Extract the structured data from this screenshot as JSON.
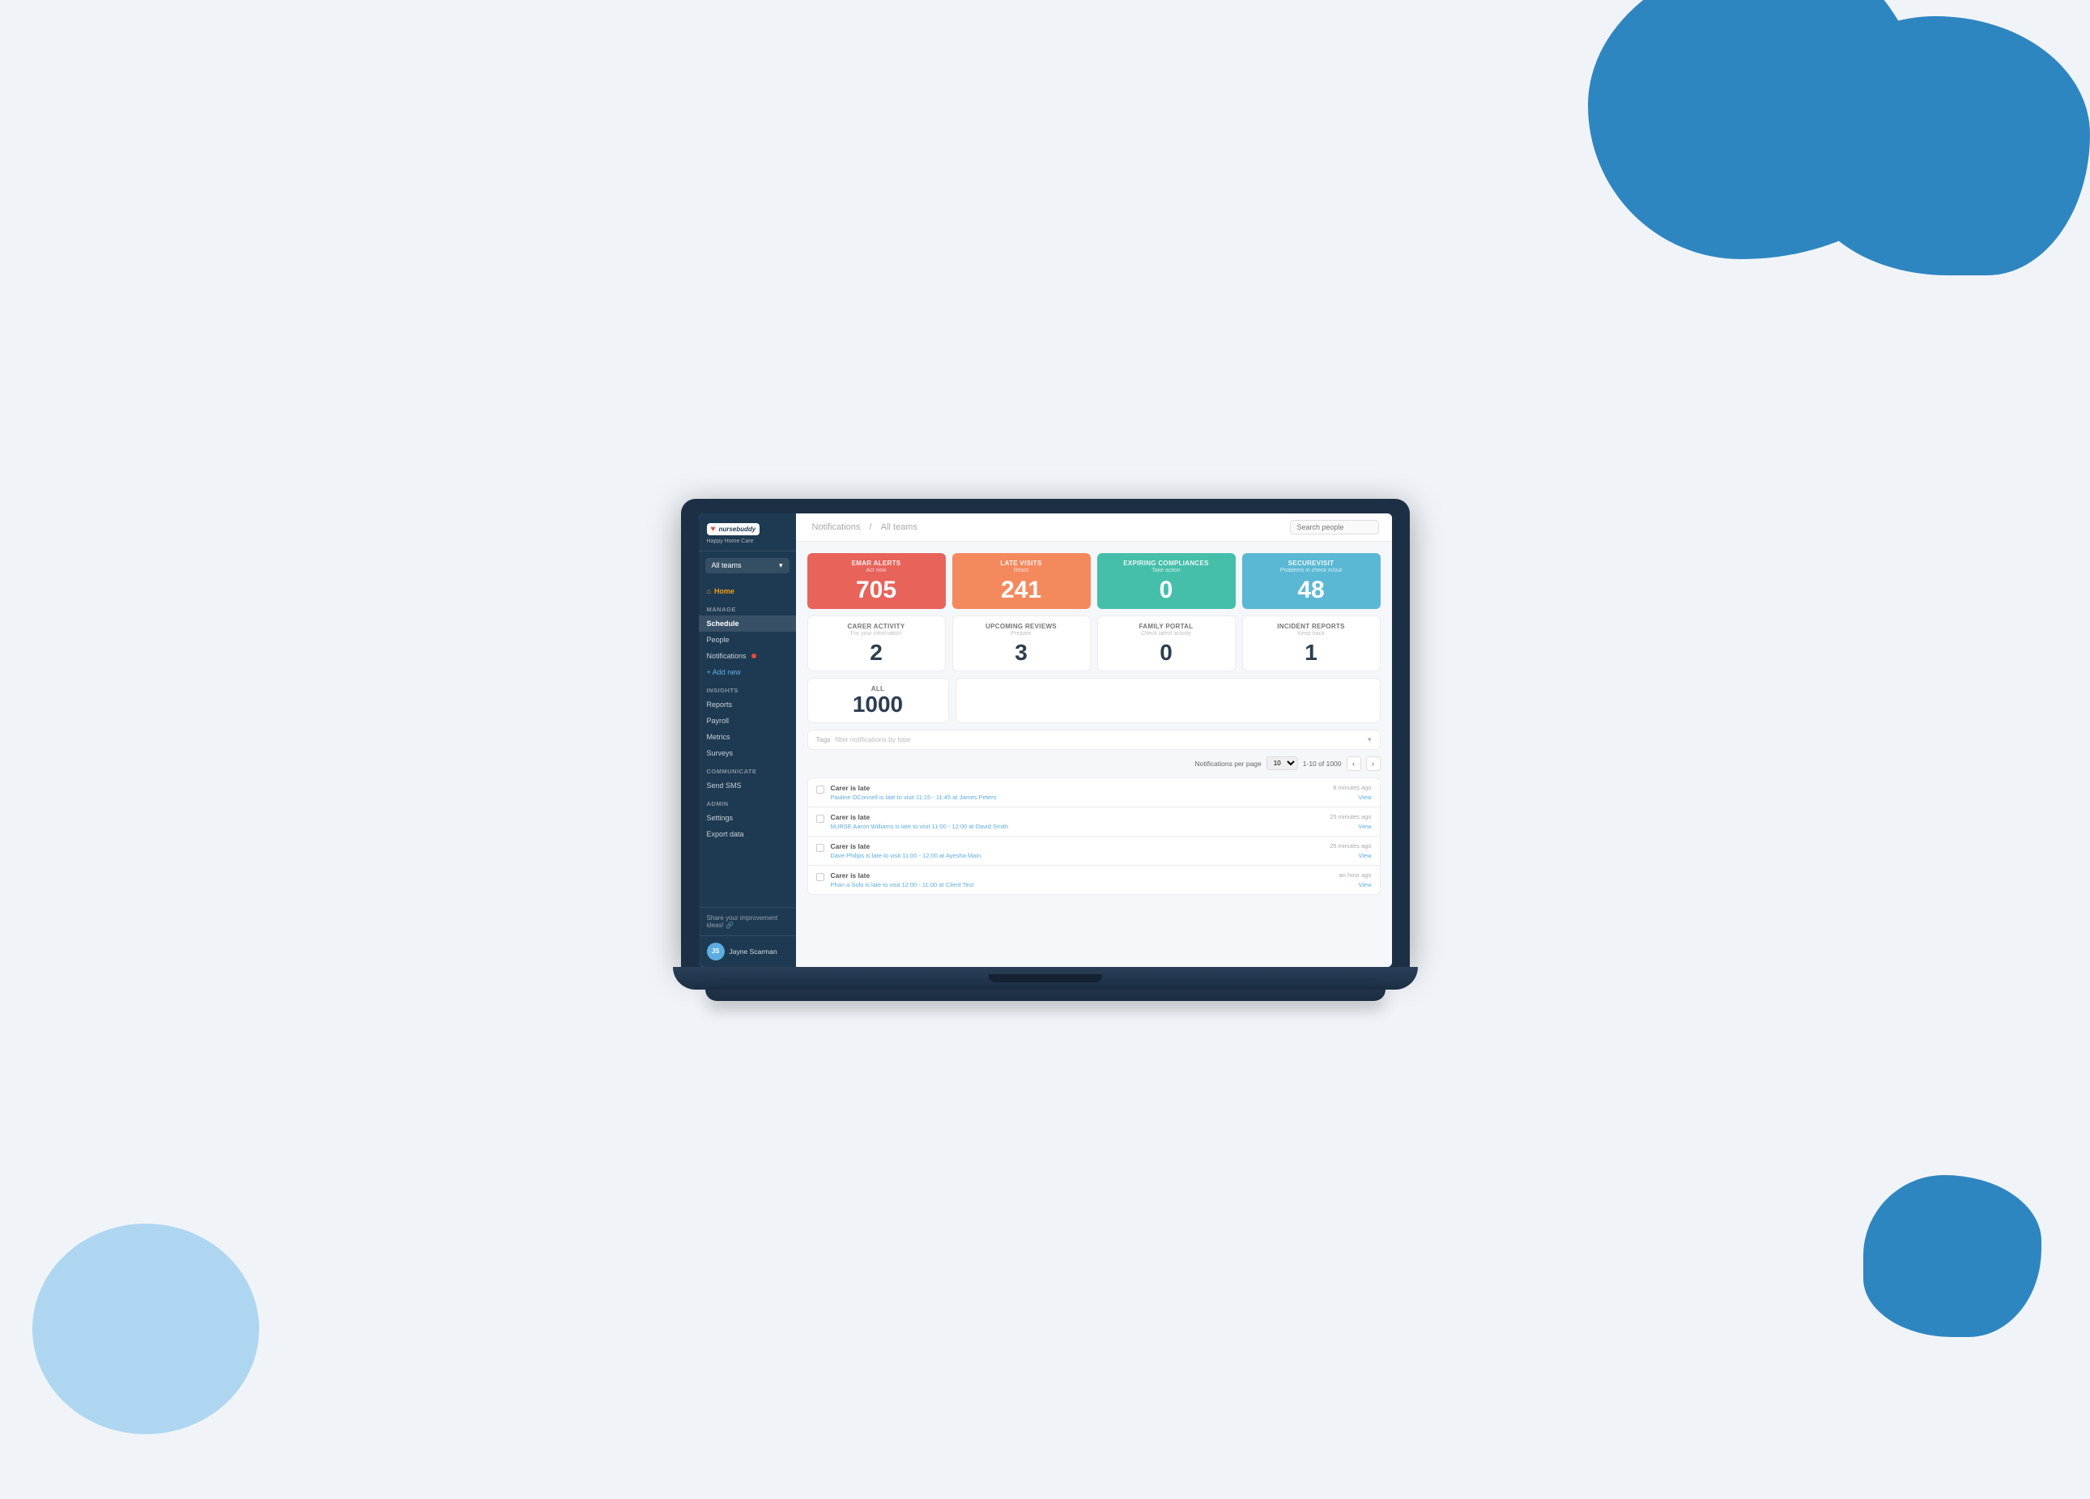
{
  "background": {
    "color": "#e8f4fb"
  },
  "laptop": {
    "screen": {
      "sidebar": {
        "logo": {
          "text": "nursebuddy",
          "tagline": "Happy Home Care"
        },
        "team_selector": {
          "label": "All teams",
          "arrow": "▾"
        },
        "nav": {
          "home": "Home",
          "sections": [
            {
              "label": "Manage",
              "items": [
                {
                  "id": "schedule",
                  "label": "Schedule",
                  "active": true
                },
                {
                  "id": "people",
                  "label": "People"
                },
                {
                  "id": "notifications",
                  "label": "Notifications",
                  "badge": true
                },
                {
                  "id": "add-new",
                  "label": "+ Add new",
                  "is_add": true
                }
              ]
            },
            {
              "label": "Insights",
              "items": [
                {
                  "id": "reports",
                  "label": "Reports"
                },
                {
                  "id": "payroll",
                  "label": "Payroll"
                },
                {
                  "id": "metrics",
                  "label": "Metrics"
                },
                {
                  "id": "surveys",
                  "label": "Surveys"
                }
              ]
            },
            {
              "label": "Communicate",
              "items": [
                {
                  "id": "send-sms",
                  "label": "Send SMS"
                }
              ]
            },
            {
              "label": "Admin",
              "items": [
                {
                  "id": "settings",
                  "label": "Settings"
                },
                {
                  "id": "export-data",
                  "label": "Export data"
                }
              ]
            }
          ]
        },
        "share": "Share your improvement ideas! 🔗",
        "user": {
          "name": "Jayne Scarman",
          "initials": "JS"
        }
      },
      "topbar": {
        "breadcrumb": {
          "section": "Notifications",
          "separator": "/",
          "sub": "All teams"
        },
        "search_placeholder": "Search people"
      },
      "stats": {
        "row1": [
          {
            "id": "emar-alerts",
            "title": "eMAR alerts",
            "subtitle": "Act now",
            "value": "705",
            "color": "red"
          },
          {
            "id": "late-visits",
            "title": "Late visits",
            "subtitle": "React",
            "value": "241",
            "color": "orange"
          },
          {
            "id": "expiring-compliances",
            "title": "Expiring compliances",
            "subtitle": "Take action",
            "value": "0",
            "color": "teal"
          },
          {
            "id": "secure-visit",
            "title": "SecureVisit",
            "subtitle": "Problems in check in/out",
            "value": "48",
            "color": "blue-light"
          }
        ],
        "row2": [
          {
            "id": "carer-activity",
            "title": "Carer activity",
            "subtitle": "For your information",
            "value": "2",
            "color": "white"
          },
          {
            "id": "upcoming-reviews",
            "title": "Upcoming reviews",
            "subtitle": "Prepare",
            "value": "3",
            "color": "white"
          },
          {
            "id": "family-portal",
            "title": "Family portal",
            "subtitle": "Check latest activity",
            "value": "0",
            "color": "white"
          },
          {
            "id": "incident-reports",
            "title": "Incident reports",
            "subtitle": "Keep track",
            "value": "1",
            "color": "white"
          }
        ],
        "row3": [
          {
            "id": "all",
            "title": "All",
            "value": "1000",
            "color": "white"
          }
        ]
      },
      "tags": {
        "label": "Tags",
        "placeholder": "filter notifications by type"
      },
      "pagination": {
        "per_page_label": "Notifications per page",
        "per_page_value": "10",
        "range": "1-10 of 1000",
        "prev": "‹",
        "next": "›"
      },
      "notifications": [
        {
          "id": "notif-1",
          "type": "Carer is late",
          "time": "8 minutes ago",
          "detail": "Pauline OConnell is late to visit 11:15 - 11:45 at James Peters",
          "view_label": "View"
        },
        {
          "id": "notif-2",
          "type": "Carer is late",
          "time": "25 minutes ago",
          "detail": "NURSE Aaron Williams is late to visit 11:00 - 12:00 at David Smith",
          "view_label": "View"
        },
        {
          "id": "notif-3",
          "type": "Carer is late",
          "time": "25 minutes ago",
          "detail": "Dave Philips is late to visit 11:00 - 12:00 at Ayesha Main",
          "view_label": "View"
        },
        {
          "id": "notif-4",
          "type": "Carer is late",
          "time": "an hour ago",
          "detail": "Phan a Solo is late to visit 12:00 - 11:00 at Client Test",
          "view_label": "View"
        }
      ]
    }
  }
}
